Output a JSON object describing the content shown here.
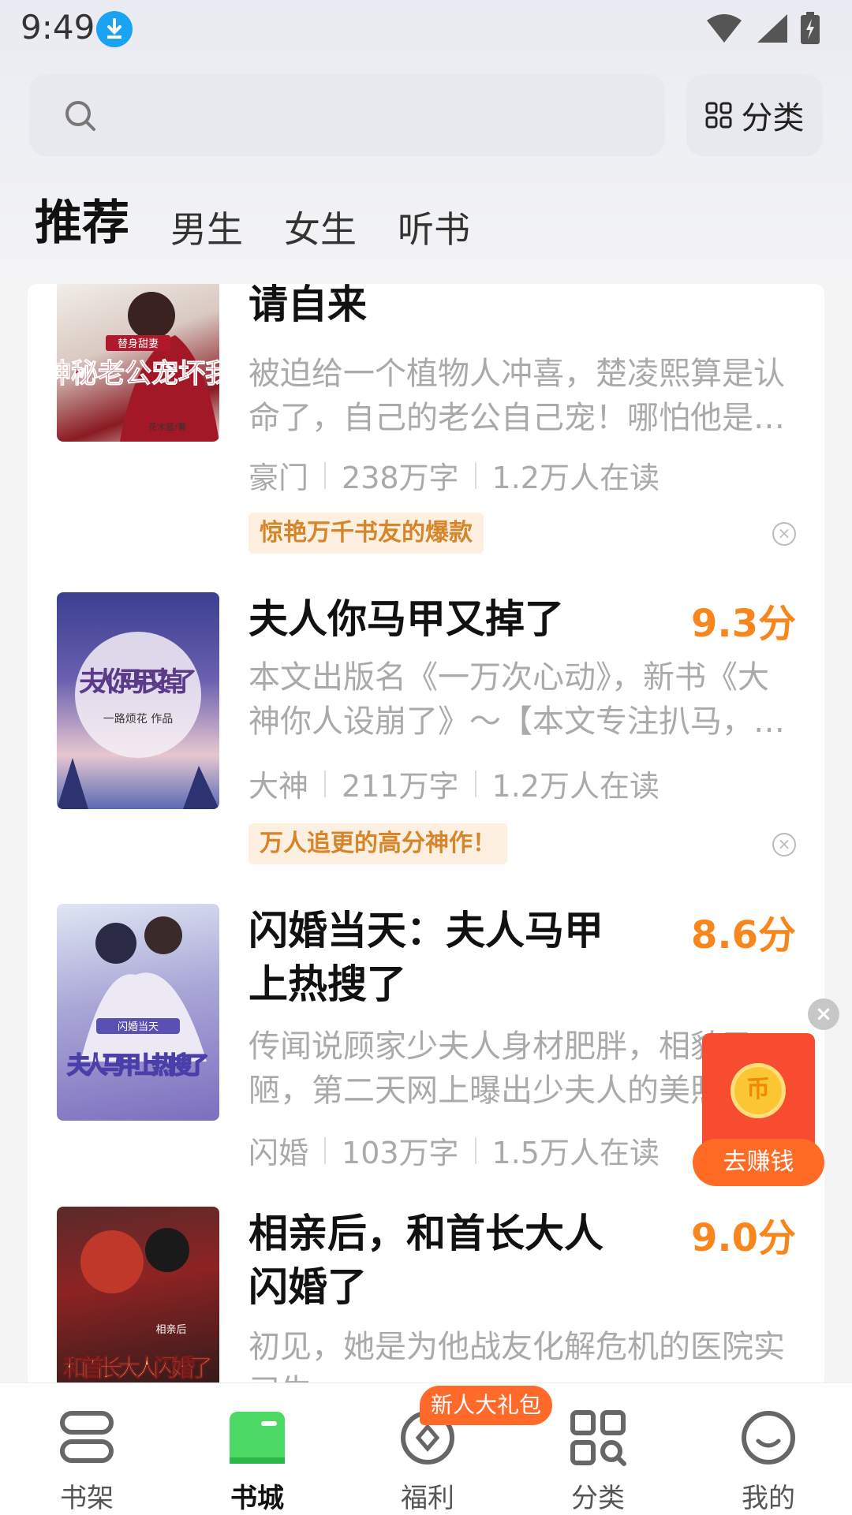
{
  "status_bar": {
    "time": "9:49"
  },
  "search": {
    "placeholder": "",
    "category_label": "分类"
  },
  "tabs": [
    {
      "label": "推荐",
      "active": true
    },
    {
      "label": "男生",
      "active": false
    },
    {
      "label": "女生",
      "active": false
    },
    {
      "label": "听书",
      "active": false
    }
  ],
  "books": [
    {
      "title": "请自来",
      "score": "",
      "desc": "被迫给一个植物人冲喜，楚凌熙算是认命了，自己的老公自己宠！哪怕他是个…",
      "genre": "豪门",
      "words": "238万字",
      "readers": "1.2万人在读",
      "tag": "惊艳万千书友的爆款",
      "cover_text": "神秘老公宠坏我",
      "cover_sub": "替身甜妻",
      "cover_author": "花木蓝/著"
    },
    {
      "title": "夫人你马甲又掉了",
      "score": "9.3分",
      "desc": "本文出版名《一万次心动》，新书《大神你人设崩了》～【本文专注扒马，女…",
      "genre": "大神",
      "words": "211万字",
      "readers": "1.2万人在读",
      "tag": "万人追更的高分神作！",
      "cover_text": "夫人你马甲又掉了",
      "cover_sub": "一路烦花 作品"
    },
    {
      "title": "闪婚当天：夫人马甲上热搜了",
      "score": "8.6分",
      "desc": "传闻说顾家少夫人身材肥胖，相貌丑陋，第二天网上曝出少夫人的美照…",
      "genre": "闪婚",
      "words": "103万字",
      "readers": "1.5万人在读",
      "tag": "",
      "cover_text": "夫人马甲上热搜了",
      "cover_sub": "闪婚当天"
    },
    {
      "title": "相亲后，和首长大人闪婚了",
      "score": "9.0分",
      "desc": "初见，她是为他战友化解危机的医院实习生…",
      "genre": "",
      "words": "",
      "readers": "",
      "tag": "",
      "cover_text": "和首长大人闪婚了",
      "cover_sub": "相亲后"
    }
  ],
  "float_ad": {
    "label": "去赚钱",
    "coin_glyph": "币"
  },
  "bottom_nav": {
    "items": [
      {
        "label": "书架",
        "icon": "bookshelf-icon",
        "active": false
      },
      {
        "label": "书城",
        "icon": "bookstore-icon",
        "active": true
      },
      {
        "label": "福利",
        "icon": "welfare-icon",
        "active": false
      },
      {
        "label": "分类",
        "icon": "category-icon",
        "active": false
      },
      {
        "label": "我的",
        "icon": "profile-icon",
        "active": false
      }
    ],
    "gift_badge": "新人大礼包"
  },
  "colors": {
    "accent": "#f7871c",
    "active_tab": "#4cd964",
    "tag_bg": "#fdf0e0",
    "tag_text": "#d7852a",
    "ad_red": "#f74c2f"
  }
}
